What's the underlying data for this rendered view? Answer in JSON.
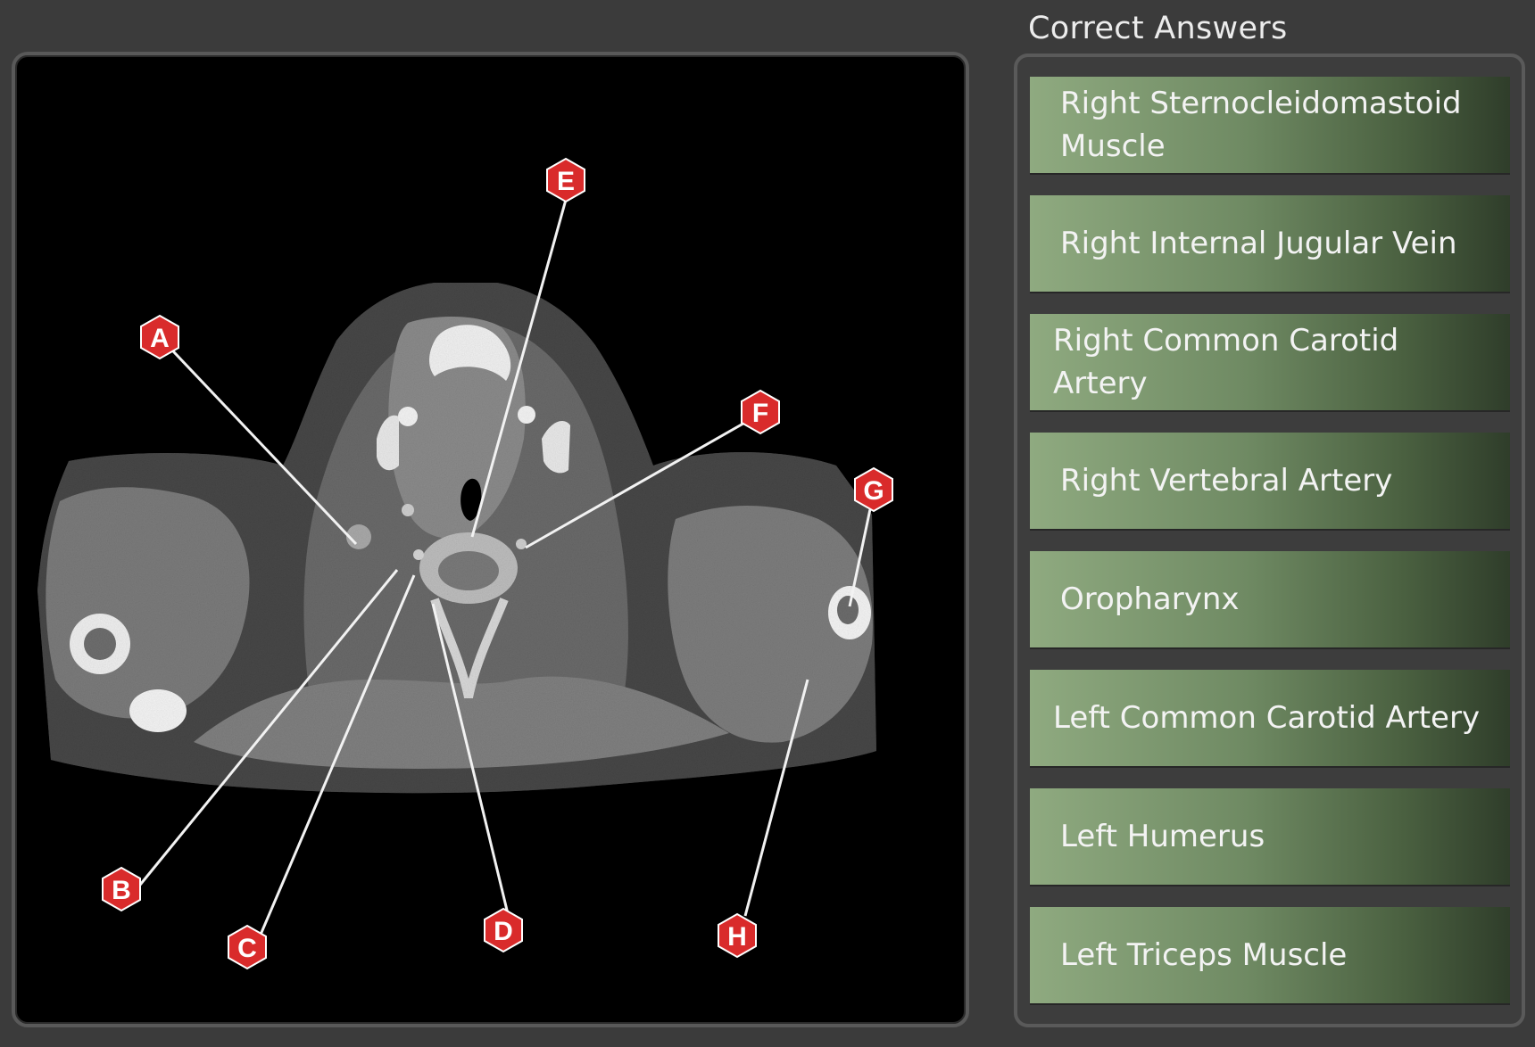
{
  "panel": {
    "title": "Correct Answers",
    "answers": [
      "Right Sternocleidomastoid Muscle",
      "Right Internal Jugular Vein",
      "Right Common Carotid Artery",
      "Right Vertebral Artery",
      "Oropharynx",
      "Left Common Carotid Artery",
      "Left Humerus",
      "Left Triceps Muscle"
    ]
  },
  "markers": {
    "a": "A",
    "b": "B",
    "c": "C",
    "d": "D",
    "e": "E",
    "f": "F",
    "g": "G",
    "h": "H"
  },
  "colors": {
    "marker_fill": "#d92b2b",
    "answer_gradient_start": "#8faa80",
    "answer_gradient_end": "#2f3d2a"
  }
}
